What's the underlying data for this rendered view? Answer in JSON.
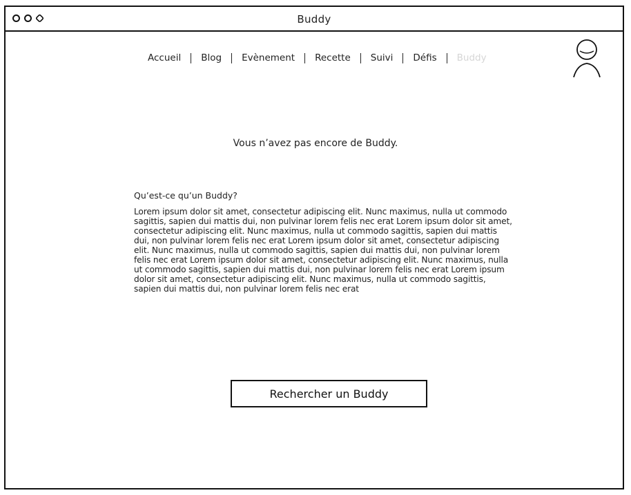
{
  "window": {
    "title": "Buddy",
    "controls": [
      "close-control",
      "minimize-control",
      "maximize-control"
    ]
  },
  "nav": {
    "items": [
      {
        "label": "Accueil",
        "active": false
      },
      {
        "label": "Blog",
        "active": false
      },
      {
        "label": "Evènement",
        "active": false
      },
      {
        "label": "Recette",
        "active": false
      },
      {
        "label": "Suivi",
        "active": false
      },
      {
        "label": "Défis",
        "active": false
      },
      {
        "label": "Buddy",
        "active": true
      }
    ],
    "avatar_icon": "user-avatar-icon"
  },
  "main": {
    "notice": "Vous n’avez pas encore de Buddy.",
    "section_title": "Qu’est-ce qu’un Buddy?",
    "section_body": "Lorem ipsum dolor sit amet, consectetur adipiscing elit. Nunc maximus, nulla ut commodo sagittis, sapien dui mattis dui, non pulvinar lorem felis nec erat Lorem ipsum dolor sit amet, consectetur adipiscing elit. Nunc maximus, nulla ut commodo sagittis, sapien dui mattis dui, non pulvinar lorem felis nec erat Lorem ipsum dolor sit amet, consectetur adipiscing elit. Nunc maximus, nulla ut commodo sagittis, sapien dui mattis dui, non pulvinar lorem felis nec erat Lorem ipsum dolor sit amet, consectetur adipiscing elit. Nunc maximus, nulla ut commodo sagittis, sapien dui mattis dui, non pulvinar lorem felis nec erat Lorem ipsum dolor sit amet, consectetur adipiscing elit. Nunc maximus, nulla ut commodo sagittis, sapien dui mattis dui, non pulvinar lorem felis nec erat",
    "search_button_label": "Rechercher un Buddy"
  },
  "colors": {
    "border": "#111111",
    "active_nav": "#d6d6d6",
    "background": "#ffffff"
  }
}
